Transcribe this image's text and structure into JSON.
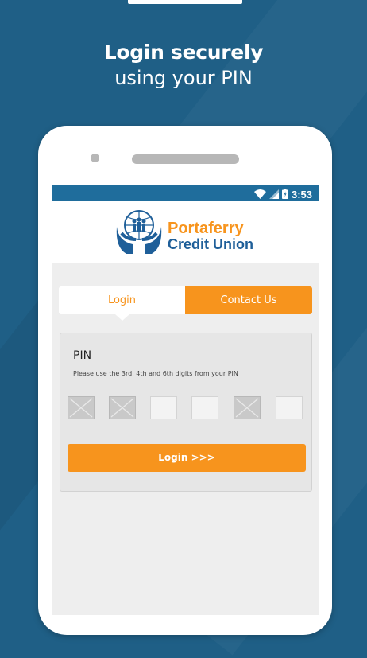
{
  "promo": {
    "title_line1": "Login securely",
    "title_line2": "using your PIN"
  },
  "statusbar": {
    "time": "3:53",
    "icons": [
      "wifi-icon",
      "signal-icon",
      "battery-icon"
    ]
  },
  "brand": {
    "name_line1": "Portaferry",
    "name_line2": "Credit Union",
    "colors": {
      "orange": "#f7941d",
      "blue": "#1f5f99"
    }
  },
  "tabs": [
    {
      "label": "Login",
      "selected": true
    },
    {
      "label": "Contact Us",
      "selected": false
    }
  ],
  "pin_form": {
    "title": "PIN",
    "hint": "Please use the 3rd, 4th and 6th digits from your PIN",
    "digits": [
      {
        "position": 1,
        "enabled": false
      },
      {
        "position": 2,
        "enabled": false
      },
      {
        "position": 3,
        "enabled": true
      },
      {
        "position": 4,
        "enabled": true
      },
      {
        "position": 5,
        "enabled": false
      },
      {
        "position": 6,
        "enabled": true
      }
    ],
    "submit_label": "Login >>>"
  },
  "colors": {
    "background": "#1f5f86",
    "statusbar": "#1f6d9c",
    "accent": "#f7941d"
  }
}
